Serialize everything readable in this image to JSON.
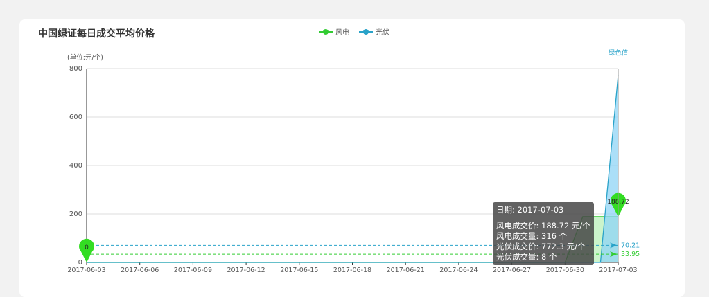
{
  "chart_data": {
    "type": "line",
    "title": "中国绿证每日成交平均价格",
    "ylabel": "(单位:元/个)",
    "ylim": [
      0,
      800
    ],
    "yticks": [
      0,
      200,
      400,
      600,
      800
    ],
    "x_ticks": [
      "2017-06-03",
      "2017-06-06",
      "2017-06-09",
      "2017-06-12",
      "2017-06-15",
      "2017-06-18",
      "2017-06-21",
      "2017-06-24",
      "2017-06-27",
      "2017-06-30",
      "2017-07-03"
    ],
    "x": [
      "2017-06-03",
      "2017-06-04",
      "2017-06-05",
      "2017-06-06",
      "2017-06-07",
      "2017-06-08",
      "2017-06-09",
      "2017-06-10",
      "2017-06-11",
      "2017-06-12",
      "2017-06-13",
      "2017-06-14",
      "2017-06-15",
      "2017-06-16",
      "2017-06-17",
      "2017-06-18",
      "2017-06-19",
      "2017-06-20",
      "2017-06-21",
      "2017-06-22",
      "2017-06-23",
      "2017-06-24",
      "2017-06-25",
      "2017-06-26",
      "2017-06-27",
      "2017-06-28",
      "2017-06-29",
      "2017-06-30",
      "2017-07-01",
      "2017-07-02",
      "2017-07-03"
    ],
    "series": [
      {
        "name": "风电",
        "color": "#33cc33",
        "fill": "#b9f0b9",
        "values": [
          0,
          0,
          0,
          0,
          0,
          0,
          0,
          0,
          0,
          0,
          0,
          0,
          0,
          0,
          0,
          0,
          0,
          0,
          0,
          0,
          0,
          0,
          0,
          0,
          0,
          0,
          0,
          0,
          188.72,
          188.72,
          188.72
        ]
      },
      {
        "name": "光伏",
        "color": "#2aa3c9",
        "fill": "#8fd4f5",
        "values": [
          0,
          0,
          0,
          0,
          0,
          0,
          0,
          0,
          0,
          0,
          0,
          0,
          0,
          0,
          0,
          0,
          0,
          0,
          0,
          0,
          0,
          0,
          0,
          0,
          0,
          0,
          0,
          0,
          0,
          0,
          772.3
        ]
      }
    ],
    "markpoints": [
      {
        "series": "风电",
        "label": "0",
        "x": "2017-06-03",
        "y": 0,
        "color": "#33dd22"
      },
      {
        "series": "风电",
        "label": "188.72",
        "x": "2017-07-03",
        "y": 188.72,
        "color": "#33dd22"
      }
    ],
    "marklines": [
      {
        "series": "光伏",
        "label": "70.21",
        "value": 70.21,
        "color": "#2aa3c9"
      },
      {
        "series": "风电",
        "label": "33.95",
        "value": 33.95,
        "color": "#33cc33"
      }
    ],
    "annotation": {
      "text": "绿色值",
      "x": "2017-07-03",
      "y": 772.3,
      "color": "#2aa3c9"
    },
    "grid": true,
    "legend_position": "top-center"
  },
  "tooltip": {
    "date": "日期: 2017-07-03",
    "lines": [
      "风电成交价: 188.72 元/个",
      "风电成交量: 316 个",
      "光伏成交价: 772.3 元/个",
      "光伏成交量: 8 个"
    ]
  }
}
